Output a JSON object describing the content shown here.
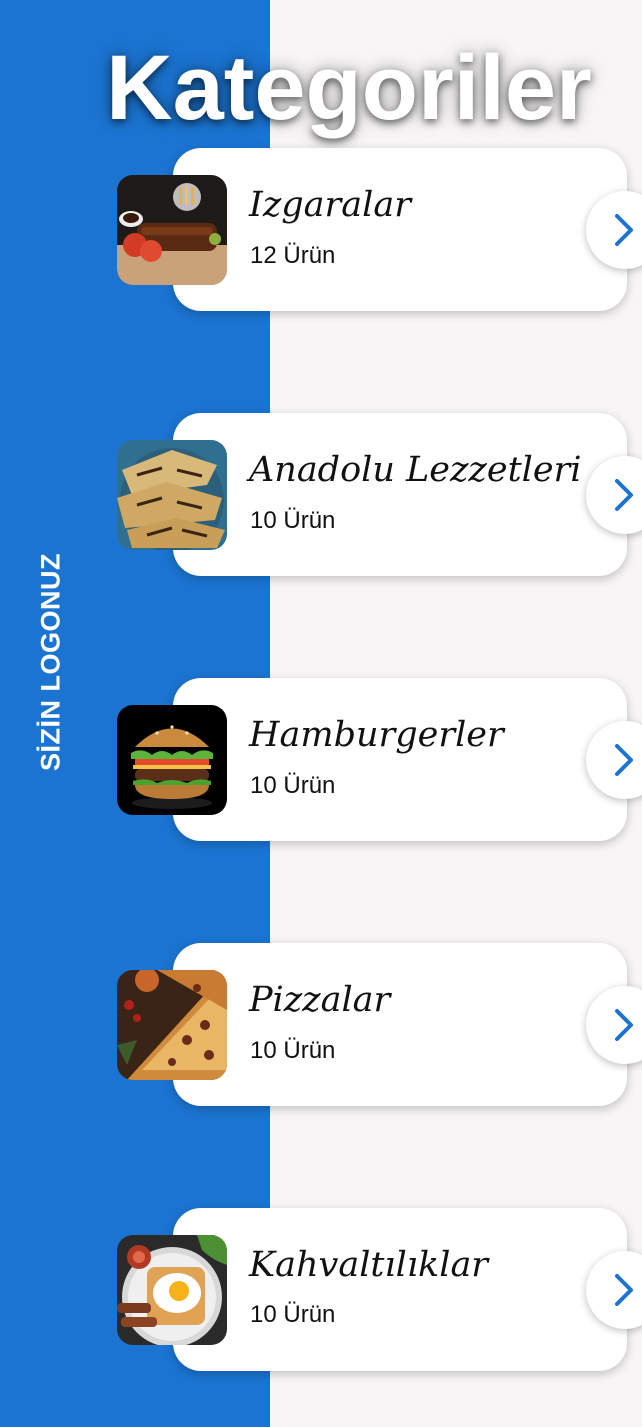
{
  "page": {
    "title": "Kategoriler",
    "logo_text": "SİZİN LOGONUZ"
  },
  "colors": {
    "accent": "#1b74d1",
    "background": "#f7f5f6",
    "card": "#ffffff"
  },
  "categories": [
    {
      "name": "Izgaralar",
      "count": "12 Ürün",
      "image": "grilled-ribs-image"
    },
    {
      "name": "Anadolu Lezzetleri",
      "count": "10 Ürün",
      "image": "gozleme-image"
    },
    {
      "name": "Hamburgerler",
      "count": "10 Ürün",
      "image": "hamburger-image"
    },
    {
      "name": "Pizzalar",
      "count": "10 Ürün",
      "image": "pizza-image"
    },
    {
      "name": "Kahvaltılıklar",
      "count": "10 Ürün",
      "image": "breakfast-image"
    }
  ],
  "icons": {
    "next": "chevron-right-icon"
  }
}
